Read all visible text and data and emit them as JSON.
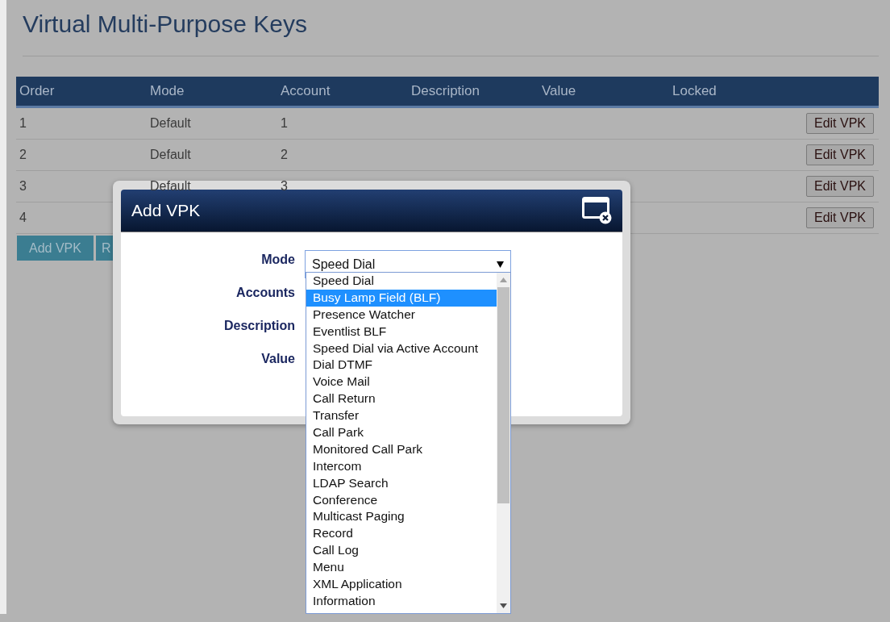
{
  "page": {
    "title": "Virtual Multi-Purpose Keys"
  },
  "table": {
    "columns": [
      "Order",
      "Mode",
      "Account",
      "Description",
      "Value",
      "Locked"
    ],
    "rows": [
      {
        "order": "1",
        "mode": "Default",
        "account": "1",
        "action": "Edit VPK"
      },
      {
        "order": "2",
        "mode": "Default",
        "account": "2",
        "action": "Edit VPK"
      },
      {
        "order": "3",
        "mode": "Default",
        "account": "3",
        "action": "Edit VPK"
      },
      {
        "order": "4",
        "mode": "",
        "account": "",
        "action": "Edit VPK"
      }
    ]
  },
  "buttons": [
    "Add VPK",
    "R"
  ],
  "dialog": {
    "title": "Add VPK",
    "fields": [
      {
        "label": "Mode",
        "kind": "select",
        "value": "Speed Dial"
      },
      {
        "label": "Accounts",
        "kind": "hidden"
      },
      {
        "label": "Description",
        "kind": "hidden"
      },
      {
        "label": "Value",
        "kind": "hidden"
      }
    ],
    "options": [
      {
        "label": "Speed Dial",
        "selected": false
      },
      {
        "label": "Busy Lamp Field (BLF)",
        "selected": true
      },
      {
        "label": "Presence Watcher",
        "selected": false
      },
      {
        "label": "Eventlist BLF",
        "selected": false
      },
      {
        "label": "Speed Dial via Active Account",
        "selected": false
      },
      {
        "label": "Dial DTMF",
        "selected": false
      },
      {
        "label": "Voice Mail",
        "selected": false
      },
      {
        "label": "Call Return",
        "selected": false
      },
      {
        "label": "Transfer",
        "selected": false
      },
      {
        "label": "Call Park",
        "selected": false
      },
      {
        "label": "Monitored Call Park",
        "selected": false
      },
      {
        "label": "Intercom",
        "selected": false
      },
      {
        "label": "LDAP Search",
        "selected": false
      },
      {
        "label": "Conference",
        "selected": false
      },
      {
        "label": "Multicast Paging",
        "selected": false
      },
      {
        "label": "Record",
        "selected": false
      },
      {
        "label": "Call Log",
        "selected": false
      },
      {
        "label": "Menu",
        "selected": false
      },
      {
        "label": "XML Application",
        "selected": false
      },
      {
        "label": "Information",
        "selected": false
      }
    ]
  }
}
